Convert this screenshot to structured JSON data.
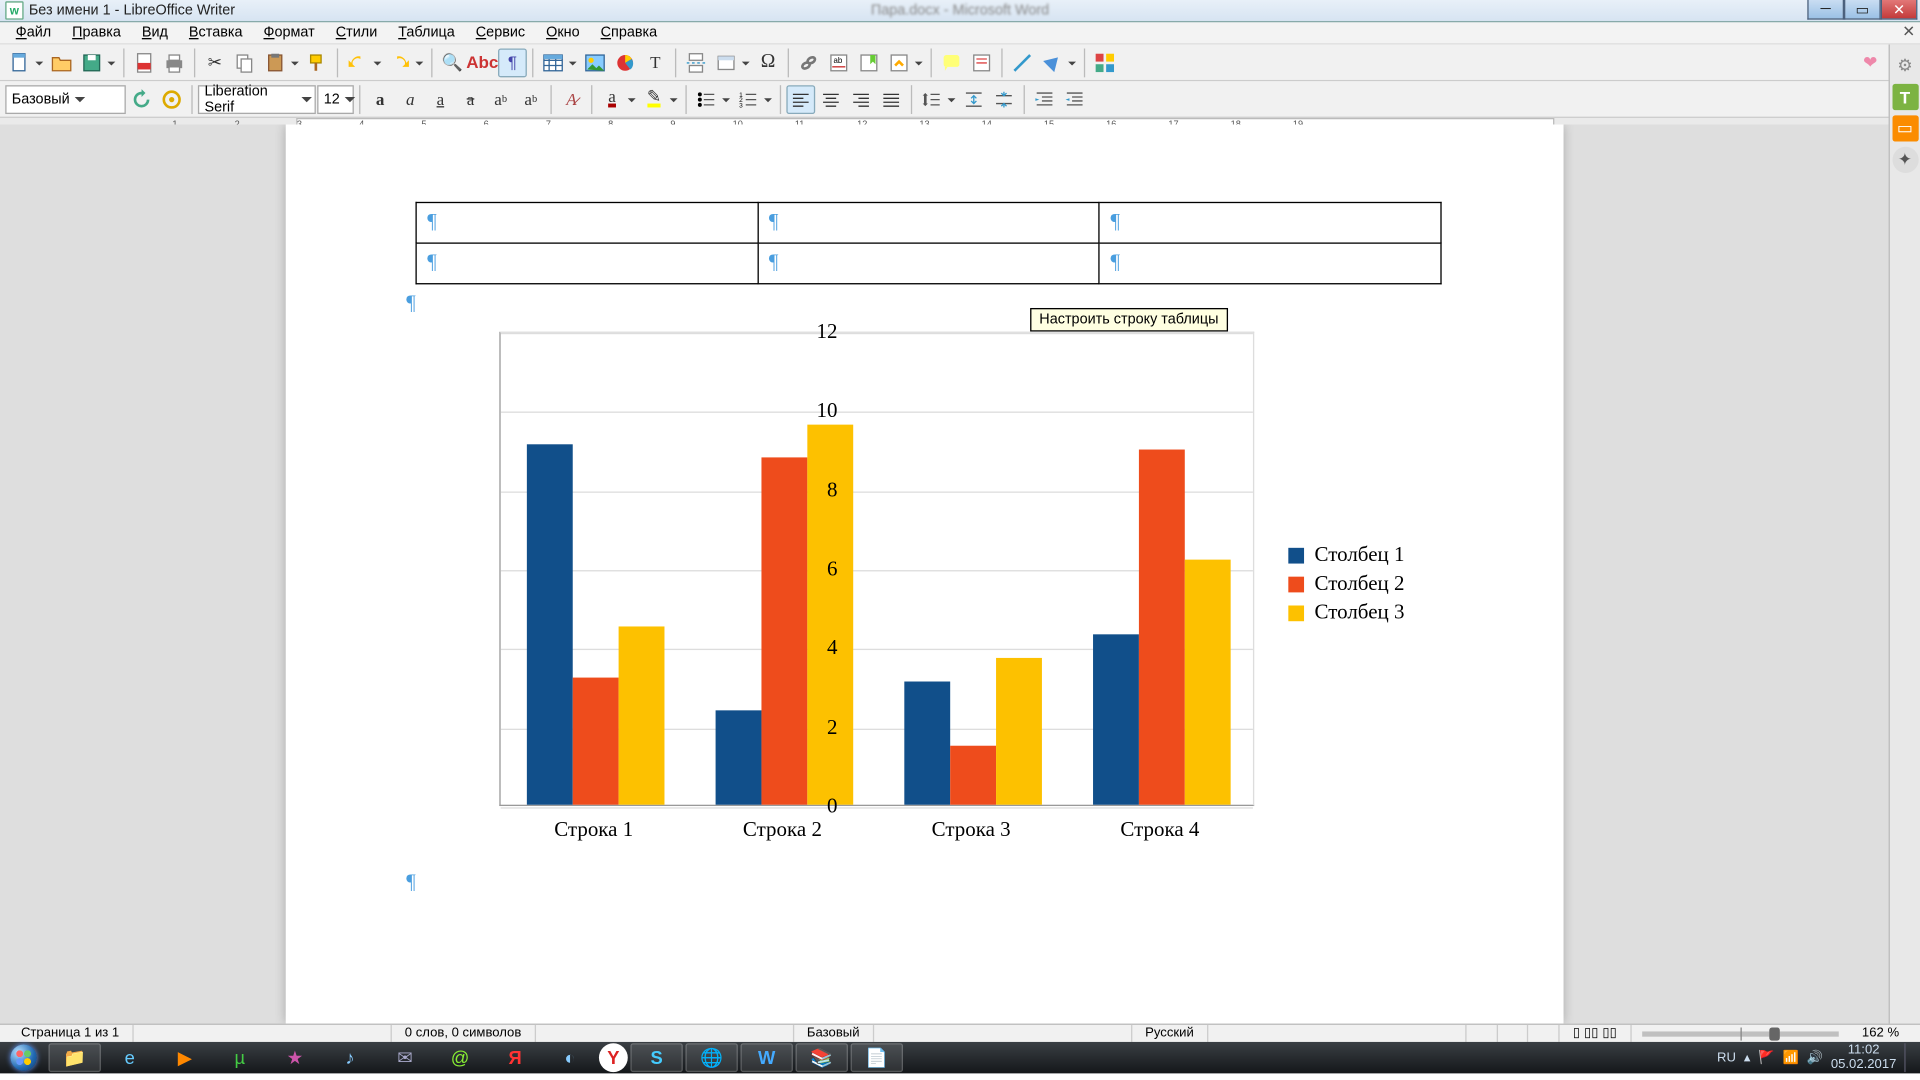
{
  "window": {
    "title": "Без имени 1 - LibreOffice Writer",
    "blur_title": "Пара.docx - Microsoft Word"
  },
  "menu": [
    "Файл",
    "Правка",
    "Вид",
    "Вставка",
    "Формат",
    "Стили",
    "Таблица",
    "Сервис",
    "Окно",
    "Справка"
  ],
  "format_toolbar": {
    "style": "Базовый",
    "font": "Liberation Serif",
    "size": "12"
  },
  "tooltip": "Настроить строку таблицы",
  "statusbar": {
    "page": "Страница 1 из 1",
    "words": "0 слов, 0 символов",
    "style": "Базовый",
    "lang": "Русский",
    "zoom": "162 %"
  },
  "tray": {
    "lang": "RU",
    "time": "11:02",
    "date": "05.02.2017"
  },
  "chart_data": {
    "type": "bar",
    "categories": [
      "Строка 1",
      "Строка 2",
      "Строка 3",
      "Строка 4"
    ],
    "series": [
      {
        "name": "Столбец 1",
        "color": "#114f8a",
        "values": [
          9.1,
          2.4,
          3.1,
          4.3
        ]
      },
      {
        "name": "Столбец 2",
        "color": "#ee4c1c",
        "values": [
          3.2,
          8.8,
          1.5,
          9.0
        ]
      },
      {
        "name": "Столбец 3",
        "color": "#fdc100",
        "values": [
          4.5,
          9.6,
          3.7,
          6.2
        ]
      }
    ],
    "ylim": [
      0,
      12
    ],
    "yticks": [
      0,
      2,
      4,
      6,
      8,
      10,
      12
    ],
    "title": "",
    "xlabel": "",
    "ylabel": ""
  }
}
